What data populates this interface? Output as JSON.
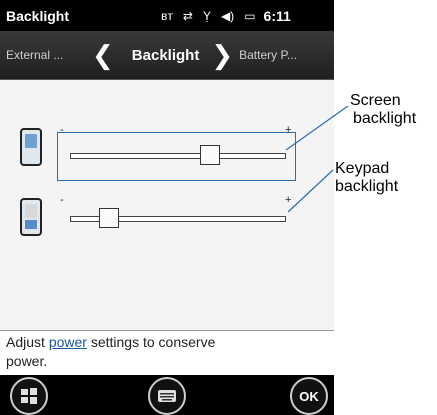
{
  "window": {
    "title": "Backlight",
    "clock": "6:11"
  },
  "status_icons": [
    "bluetooth-icon",
    "sync-icon",
    "signal-icon",
    "speaker-icon",
    "battery-icon"
  ],
  "navigation": {
    "prev": "External ...",
    "current": "Backlight",
    "next": "Battery P...",
    "prev_chevron": "❮",
    "next_chevron": "❯"
  },
  "sliders": {
    "screen": {
      "label": "Screen backlight",
      "min_label": "-",
      "max_label": "+",
      "level": 0.67
    },
    "keypad": {
      "label": "Keypad backlight",
      "min_label": "-",
      "max_label": "+",
      "level": 0.15
    }
  },
  "hint": {
    "prefix": "Adjust ",
    "link": "power",
    "suffix": " settings to conserve",
    "line2": "power."
  },
  "softkeys": {
    "ok": "OK"
  },
  "callouts": {
    "screen_line1": "Screen",
    "screen_line2": "backlight",
    "keypad_line1": "Keypad",
    "keypad_line2": "backlight"
  },
  "colors": {
    "accent": "#2b6cb0",
    "titlebar": "#000000",
    "link": "#1a55a0"
  }
}
